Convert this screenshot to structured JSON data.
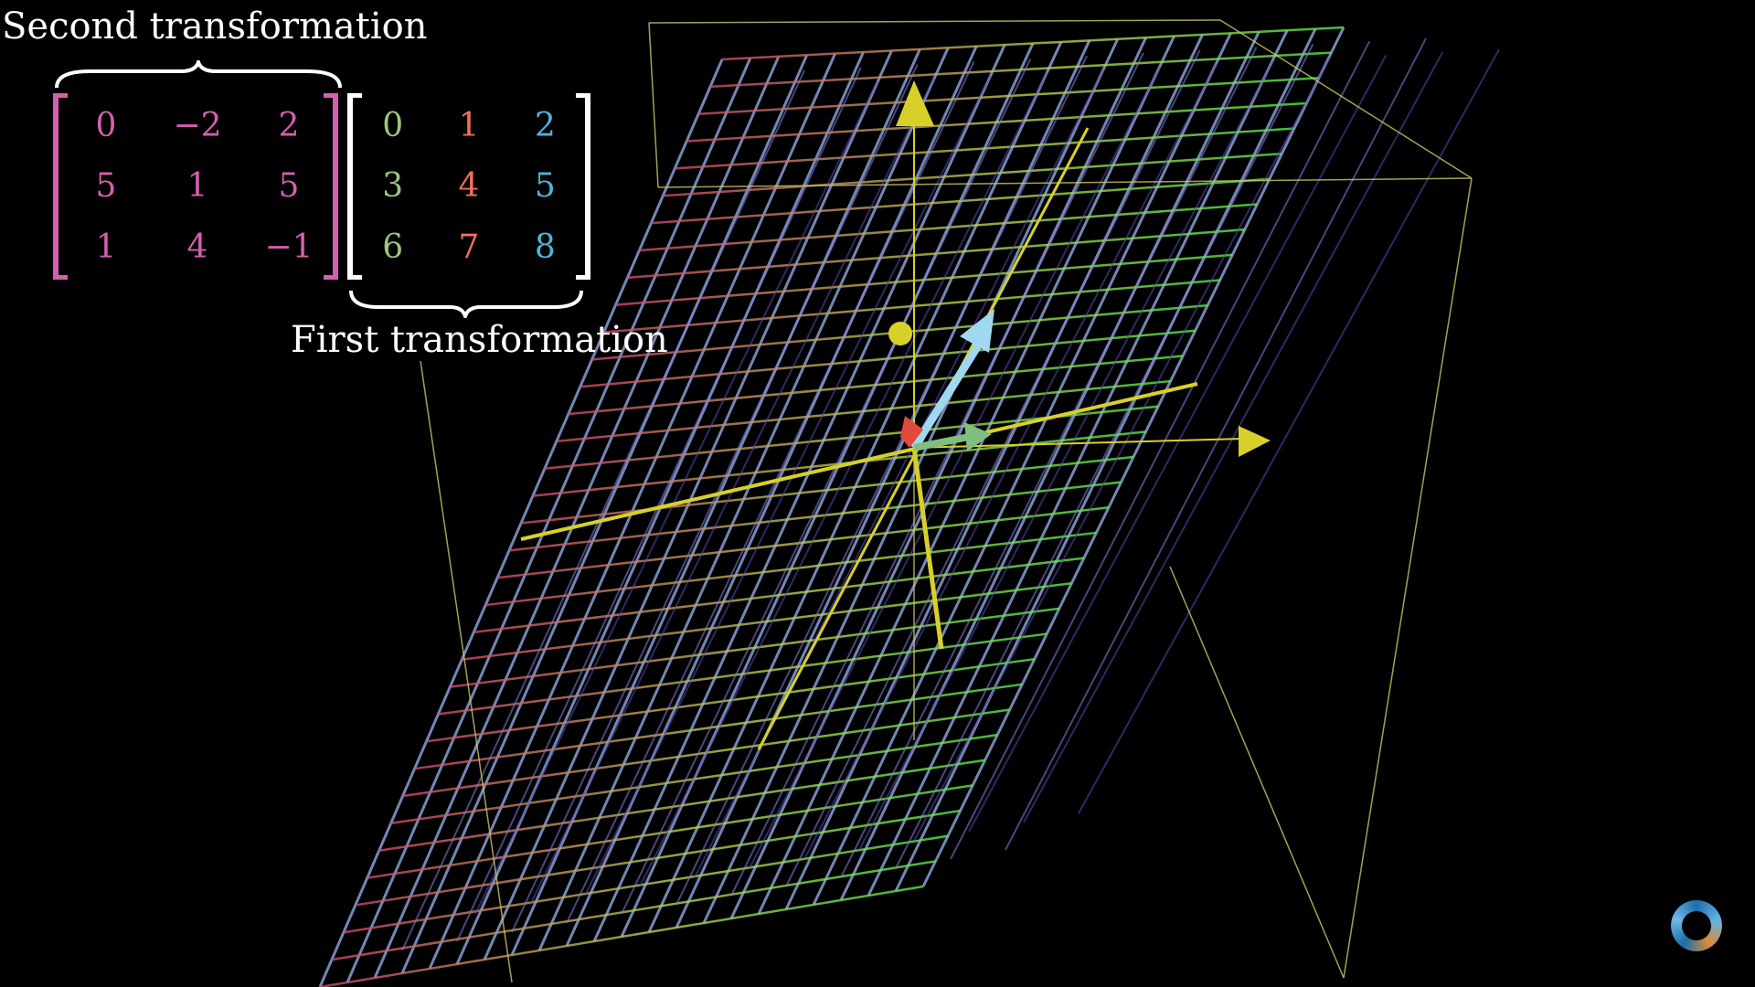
{
  "labels": {
    "second": "Second transformation",
    "first": "First transformation"
  },
  "second_matrix": {
    "color": "#d35fb0",
    "rows": [
      [
        "0",
        "−2",
        "2"
      ],
      [
        "5",
        "1",
        "5"
      ],
      [
        "1",
        "4",
        "−1"
      ]
    ]
  },
  "first_matrix": {
    "column_colors": [
      "#9bc77f",
      "#f0705a",
      "#4fb3d9"
    ],
    "rows": [
      [
        "0",
        "1",
        "2"
      ],
      [
        "3",
        "4",
        "5"
      ],
      [
        "6",
        "7",
        "8"
      ]
    ]
  },
  "colors": {
    "background": "#000000",
    "label": "#ffffff",
    "axis_yellow": "#d8d02a",
    "vector_blue": "#9fd8f0",
    "vector_red": "#e04a3a",
    "vector_green": "#7fbf7f",
    "bounding_box": "#cfc86a"
  },
  "icons": {
    "loading": "loading-spinner-icon"
  }
}
